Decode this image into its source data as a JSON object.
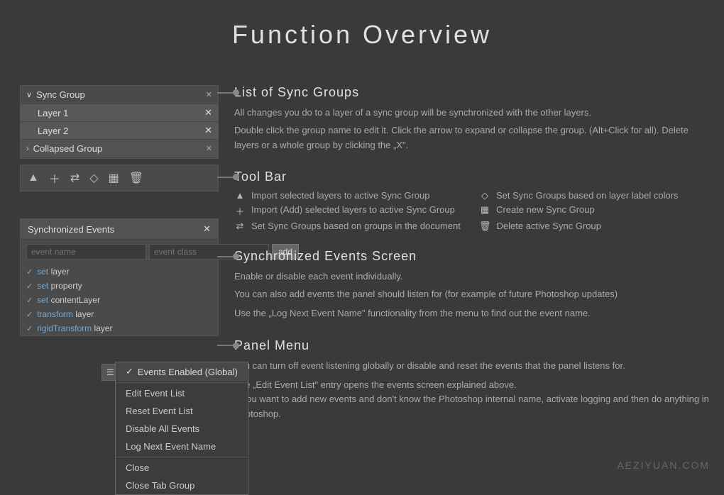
{
  "page": {
    "title": "Function  Overview"
  },
  "left": {
    "sync_group_label": "Sync Group",
    "layer1": "Layer 1",
    "layer2": "Layer 2",
    "collapsed_group": "Collapsed Group",
    "events_title": "Synchronized Events",
    "event_name_placeholder": "event name",
    "event_class_placeholder": "event class",
    "add_label": "add",
    "events": [
      {
        "check": "✓",
        "prefix": "set",
        "name": " layer"
      },
      {
        "check": "✓",
        "prefix": "set",
        "name": " property"
      },
      {
        "check": "✓",
        "prefix": "set",
        "name": " contentLayer"
      },
      {
        "check": "✓",
        "prefix": "transform",
        "name": " layer"
      },
      {
        "check": "✓",
        "prefix": "rigidTransform",
        "name": " layer"
      }
    ]
  },
  "menu": {
    "checked_item": "Events Enabled (Global)",
    "items": [
      "Edit Event List",
      "Reset Event List",
      "Disable All Events",
      "Log Next Event Name",
      "Close",
      "Close Tab Group"
    ]
  },
  "right": {
    "sections": [
      {
        "id": "sync-groups",
        "title": "List of Sync Groups",
        "paragraphs": [
          "All changes you do to a layer of a sync group will be synchronized with the other layers.",
          "Double click the group name to edit it. Click the arrow to expand or collapse the group. (Alt+Click for all). Delete layers or a whole group by clicking the „X\"."
        ]
      },
      {
        "id": "toolbar",
        "title": "Tool Bar",
        "toolbar_items": [
          {
            "icon": "▲",
            "text": "Import selected layers to active Sync Group"
          },
          {
            "icon": "◆",
            "text": "Set Sync Groups based on layer label colors"
          },
          {
            "icon": "+",
            "text": "Import (Add) selected layers to active Sync Group"
          },
          {
            "icon": "▦",
            "text": "Create new Sync Group"
          },
          {
            "icon": "⇄",
            "text": "Set Sync Groups based on groups in the document"
          },
          {
            "icon": "🗑",
            "text": "Delete active Sync Group"
          }
        ]
      },
      {
        "id": "sync-events",
        "title": "Synchronized Events Screen",
        "paragraphs": [
          "Enable or disable each event individually.",
          "You can also add events the panel should listen for (for example of future Photoshop updates)",
          "Use the „Log Next Event Name\" functionality from the menu to find out the event name."
        ]
      },
      {
        "id": "panel-menu",
        "title": "Panel Menu",
        "paragraphs": [
          "You can turn off event listening globally or disable and reset the events that the panel listens for.",
          "The „Edit Event List\" entry opens the events screen explained above.\nIf you want to add new events and don't know the Photoshop internal name, activate logging and then do anything in Photoshop."
        ]
      }
    ]
  },
  "watermark": "AEZIYUAN.COM"
}
